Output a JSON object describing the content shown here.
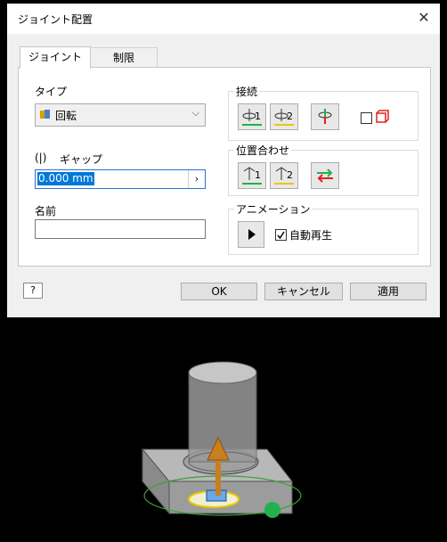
{
  "window": {
    "title": "ジョイント配置"
  },
  "tabs": [
    {
      "label": "ジョイント"
    },
    {
      "label": "制限"
    }
  ],
  "type": {
    "label": "タイプ",
    "value": "回転"
  },
  "gap": {
    "label": "ギャップ",
    "value": "0.000 mm"
  },
  "name": {
    "label": "名前",
    "value": ""
  },
  "connect": {
    "label": "接続",
    "btn1": "1",
    "btn2": "2"
  },
  "align": {
    "label": "位置合わせ",
    "btn1": "1",
    "btn2": "2"
  },
  "animation": {
    "label": "アニメーション",
    "autoplay_label": "自動再生",
    "autoplay_checked": true
  },
  "buttons": {
    "ok": "OK",
    "cancel": "キャンセル",
    "apply": "適用"
  },
  "colors": {
    "accent": "#0078d7",
    "green": "#22b14c",
    "yellow": "#e8c800",
    "red": "#e02020",
    "arrow": "#c8801e"
  },
  "icons": [
    "close-icon",
    "revolute-joint-icon",
    "chevron-down-icon",
    "gap-icon",
    "chevron-right-icon",
    "origin1-select-icon",
    "origin2-select-icon",
    "flip-icon",
    "lock-box-icon",
    "align1-icon",
    "align2-icon",
    "invert-align-icon",
    "play-icon",
    "help-icon"
  ]
}
